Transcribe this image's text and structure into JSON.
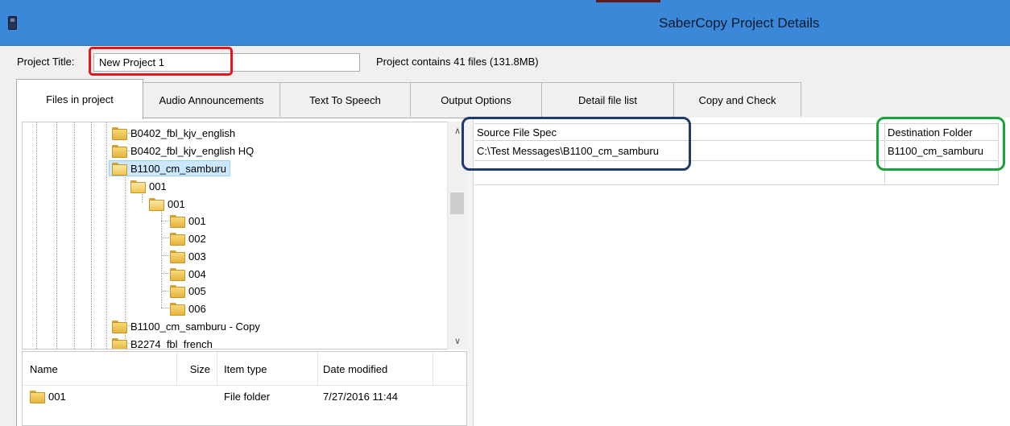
{
  "window": {
    "title": "SaberCopy Project Details"
  },
  "project": {
    "title_label": "Project Title:",
    "title_value": "New Project 1",
    "file_info": "Project contains 41 files (131.8MB)"
  },
  "tabs": [
    {
      "label": "Files in project",
      "active": true
    },
    {
      "label": "Audio Announcements",
      "active": false
    },
    {
      "label": "Text To Speech",
      "active": false
    },
    {
      "label": "Output Options",
      "active": false
    },
    {
      "label": "Detail file list",
      "active": false
    },
    {
      "label": "Copy and Check",
      "active": false
    }
  ],
  "tree": {
    "nodes": [
      {
        "label": "B0402_fbl_kjv_english",
        "expander": "collapsed"
      },
      {
        "label": "B0402_fbl_kjv_english HQ",
        "expander": "collapsed"
      },
      {
        "label": "B1100_cm_samburu",
        "expander": "expanded",
        "selected": true
      },
      {
        "label": "001",
        "expander": "expanded"
      },
      {
        "label": "001",
        "expander": "expanded"
      },
      {
        "label": "001",
        "expander": "none"
      },
      {
        "label": "002",
        "expander": "none"
      },
      {
        "label": "003",
        "expander": "none"
      },
      {
        "label": "004",
        "expander": "none"
      },
      {
        "label": "005",
        "expander": "none"
      },
      {
        "label": "006",
        "expander": "none"
      },
      {
        "label": "B1100_cm_samburu - Copy",
        "expander": "collapsed"
      },
      {
        "label": "B2274_fbl_french",
        "expander": "collapsed"
      }
    ],
    "glyphs": {
      "collapsed": "▷",
      "expanded": "◢",
      "scroll_up": "∧",
      "scroll_down": "∨"
    }
  },
  "file_list": {
    "columns": [
      "Name",
      "Size",
      "Item type",
      "Date modified"
    ],
    "rows": [
      {
        "name": "001",
        "size": "",
        "type": "File folder",
        "modified": "7/27/2016 11:44"
      }
    ]
  },
  "grid": {
    "columns": [
      "Source File Spec",
      "Destination Folder"
    ],
    "rows": [
      {
        "source": "C:\\Test Messages\\B1100_cm_samburu",
        "destination": "B1100_cm_samburu"
      }
    ]
  },
  "colors": {
    "titlebar": "#3c88d8",
    "highlight_red": "#e8141c",
    "highlight_blue": "#1f3a6e",
    "highlight_green": "#1aa33a",
    "selection": "#cce8ff"
  }
}
